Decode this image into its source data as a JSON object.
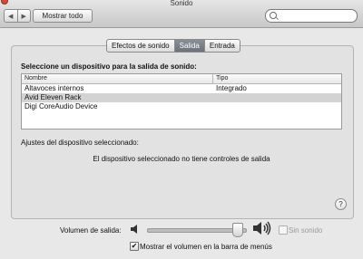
{
  "window": {
    "title": "Sonido",
    "show_all_label": "Mostrar todo",
    "search_placeholder": ""
  },
  "nav": {
    "back_symbol": "◀",
    "forward_symbol": "▶"
  },
  "tabs": [
    {
      "label": "Efectos de sonido",
      "active": false
    },
    {
      "label": "Salida",
      "active": true
    },
    {
      "label": "Entrada",
      "active": false
    }
  ],
  "output": {
    "heading": "Seleccione un dispositivo para la salida de sonido:",
    "columns": [
      "Nombre",
      "Tipo"
    ],
    "devices": [
      {
        "name": "Altavoces internos",
        "type": "Integrado",
        "selected": false
      },
      {
        "name": "Avid Eleven Rack",
        "type": "",
        "selected": true
      },
      {
        "name": "Digi CoreAudio Device",
        "type": "",
        "selected": false
      }
    ],
    "settings_label": "Ajustes del dispositivo seleccionado:",
    "no_controls_text": "El dispositivo seleccionado no tiene controles de salida"
  },
  "help": {
    "symbol": "?"
  },
  "volume": {
    "label": "Volumen de salida:",
    "level": 0.92,
    "mute_label": "Sin sonido",
    "mute_checked": false,
    "show_in_menubar_label": "Mostrar el volumen en la barra de menús",
    "show_in_menubar_checked": true,
    "check_symbol": "✔"
  },
  "colors": {
    "selected_row": "#d3d3d3",
    "active_tab": "#7a8089"
  }
}
